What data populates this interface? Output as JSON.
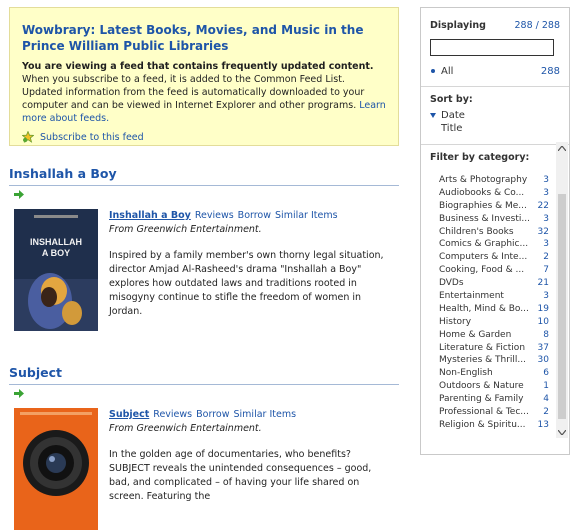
{
  "banner": {
    "title": "Wowbrary: Latest Books, Movies, and Music in the Prince William Public Libraries",
    "info_bold": "You are viewing a feed that contains frequently updated content.",
    "info_text": " When you subscribe to a feed, it is added to the Common Feed List. Updated information from the feed is automatically downloaded to your computer and can be viewed in Internet Explorer and other programs. ",
    "learn_more": "Learn more about feeds.",
    "subscribe": "Subscribe to this feed"
  },
  "items": [
    {
      "title": "Inshallah a Boy",
      "links": [
        "Inshallah a Boy",
        "Reviews",
        "Borrow",
        "Similar Items"
      ],
      "from": "From Greenwich Entertainment.",
      "description": "Inspired by a family member's own thorny legal situation, director Amjad Al-Rasheed's drama \"Inshallah a Boy\" explores how outdated laws and traditions rooted in misogyny continue to stifle the freedom of women in Jordan.",
      "poster_text": "INSHALLAH A BOY"
    },
    {
      "title": "Subject",
      "links": [
        "Subject",
        "Reviews",
        "Borrow",
        "Similar Items"
      ],
      "from": "From Greenwich Entertainment.",
      "description": "In the golden age of documentaries, who benefits? SUBJECT reveals the unintended consequences – good, bad, and complicated – of having your life shared on screen. Featuring the",
      "poster_text": ""
    }
  ],
  "pane": {
    "displaying_label": "Displaying",
    "displaying_count": "288 / 288",
    "search_value": "",
    "all_label": "All",
    "all_count": "288",
    "sort_label": "Sort by:",
    "sort_options": [
      "Date",
      "Title"
    ],
    "filter_label": "Filter by category:",
    "categories": [
      {
        "name": "Arts & Photography",
        "count": "3"
      },
      {
        "name": "Audiobooks & Co...",
        "count": "3"
      },
      {
        "name": "Biographies & Me...",
        "count": "22"
      },
      {
        "name": "Business & Investi...",
        "count": "3"
      },
      {
        "name": "Children's Books",
        "count": "32"
      },
      {
        "name": "Comics & Graphic...",
        "count": "3"
      },
      {
        "name": "Computers & Inte...",
        "count": "2"
      },
      {
        "name": "Cooking, Food & ...",
        "count": "7"
      },
      {
        "name": "DVDs",
        "count": "21"
      },
      {
        "name": "Entertainment",
        "count": "3"
      },
      {
        "name": "Health, Mind & Bo...",
        "count": "19"
      },
      {
        "name": "History",
        "count": "10"
      },
      {
        "name": "Home & Garden",
        "count": "8"
      },
      {
        "name": "Literature & Fiction",
        "count": "37"
      },
      {
        "name": "Mysteries & Thrill...",
        "count": "30"
      },
      {
        "name": "Non-English",
        "count": "6"
      },
      {
        "name": "Outdoors & Nature",
        "count": "1"
      },
      {
        "name": "Parenting & Family",
        "count": "4"
      },
      {
        "name": "Professional & Tec...",
        "count": "2"
      },
      {
        "name": "Religion & Spiritu...",
        "count": "13"
      }
    ]
  },
  "colors": {
    "link": "#1e55a8",
    "banner_bg": "#ffffc8",
    "arrow": "#3aa335"
  },
  "icons": {
    "subscribe": "feed-star-icon",
    "item_arrow": "green-arrow-icon",
    "sort_arrow": "sort-desc-triangle-icon"
  }
}
